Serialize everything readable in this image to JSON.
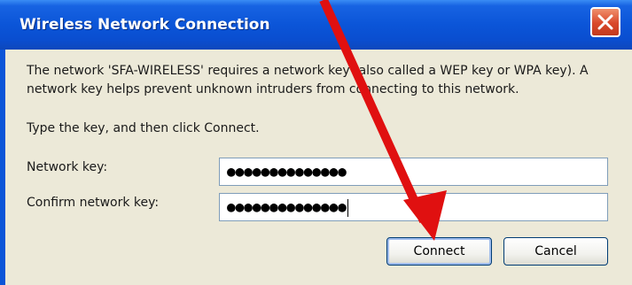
{
  "window": {
    "title": "Wireless Network Connection"
  },
  "message": {
    "line1": "The network 'SFA-WIRELESS' requires a network key (also called a WEP key or WPA key). A",
    "line2": "network key helps prevent unknown intruders from connecting to this network.",
    "instruction": "Type the key, and then click Connect."
  },
  "form": {
    "network_key_label": "Network key:",
    "network_key_value": "●●●●●●●●●●●●●●",
    "confirm_key_label": "Confirm network key:",
    "confirm_key_value": "●●●●●●●●●●●●●●"
  },
  "buttons": {
    "connect": "Connect",
    "cancel": "Cancel"
  },
  "annotation": {
    "arrow_color": "#e01010"
  },
  "colors": {
    "titlebar": "#0b55d8",
    "dialog_bg": "#ece9d8",
    "close_button": "#d9482a"
  }
}
